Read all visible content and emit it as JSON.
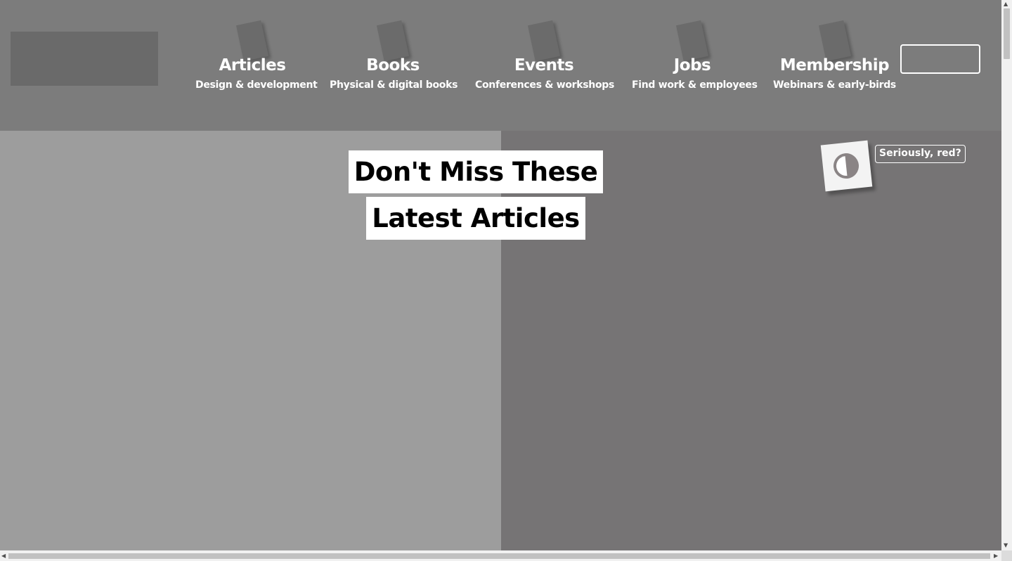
{
  "nav": [
    {
      "title": "Articles",
      "subtitle": "Design & development"
    },
    {
      "title": "Books",
      "subtitle": "Physical & digital books"
    },
    {
      "title": "Events",
      "subtitle": "Conferences & workshops"
    },
    {
      "title": "Jobs",
      "subtitle": "Find work & employees"
    },
    {
      "title": "Membership",
      "subtitle": "Webinars & early-birds"
    }
  ],
  "main": {
    "heading": "Don't Miss These Latest Articles"
  },
  "theme_toggle": {
    "icon": "contrast-icon",
    "label": "Seriously, red?"
  },
  "scrollbars": {
    "up_arrow": "▲",
    "down_arrow": "▼",
    "left_arrow": "◀",
    "right_arrow": "▶"
  },
  "colors": {
    "header_bg": "#7c7c7c",
    "left_panel": "#9d9d9d",
    "right_panel": "#767475",
    "accent": "#ffffff"
  }
}
